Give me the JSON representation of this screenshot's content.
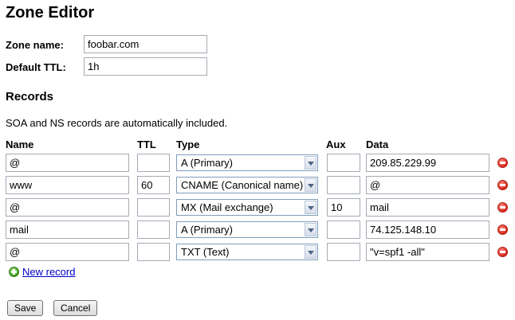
{
  "title": "Zone Editor",
  "zone_name": {
    "label": "Zone name:",
    "value": "foobar.com"
  },
  "default_ttl": {
    "label": "Default TTL:",
    "value": "1h"
  },
  "records_heading": "Records",
  "note": "SOA and NS records are automatically included.",
  "columns": {
    "name": "Name",
    "ttl": "TTL",
    "type": "Type",
    "aux": "Aux",
    "data": "Data"
  },
  "records": [
    {
      "name": "@",
      "ttl": "",
      "type": "A (Primary)",
      "aux": "",
      "data": "209.85.229.99"
    },
    {
      "name": "www",
      "ttl": "60",
      "type": "CNAME (Canonical name)",
      "aux": "",
      "data": "@"
    },
    {
      "name": "@",
      "ttl": "",
      "type": "MX (Mail exchange)",
      "aux": "10",
      "data": "mail"
    },
    {
      "name": "mail",
      "ttl": "",
      "type": "A (Primary)",
      "aux": "",
      "data": "74.125.148.10"
    },
    {
      "name": "@",
      "ttl": "",
      "type": "TXT (Text)",
      "aux": "",
      "data": "\"v=spf1 -all\""
    }
  ],
  "new_record_label": "New record",
  "save_label": "Save",
  "cancel_label": "Cancel",
  "icons": {
    "delete": "remove-icon",
    "add": "add-icon"
  }
}
